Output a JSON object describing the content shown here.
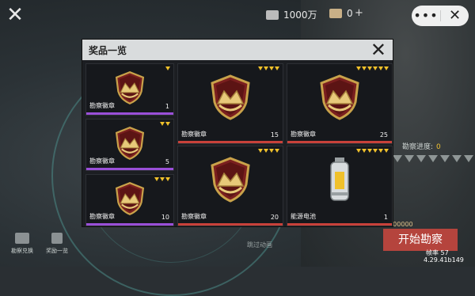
{
  "topbar": {
    "currency1": "1000万",
    "currency2": "0",
    "plus": "+",
    "close_glyph": "✕",
    "capsule_dots": "•••",
    "capsule_close": "✕"
  },
  "modal": {
    "title": "奖品一览",
    "close_glyph": "✕",
    "items": [
      {
        "name": "勘察徽章",
        "qty": "1",
        "stars": 1,
        "rarity": "purple"
      },
      {
        "name": "勘察徽章",
        "qty": "5",
        "stars": 2,
        "rarity": "purple"
      },
      {
        "name": "勘察徽章",
        "qty": "10",
        "stars": 3,
        "rarity": "purple"
      },
      {
        "name": "勘察徽章",
        "qty": "15",
        "stars": 4,
        "rarity": "red"
      },
      {
        "name": "勘察徽章",
        "qty": "20",
        "stars": 4,
        "rarity": "red"
      },
      {
        "name": "勘察徽章",
        "qty": "25",
        "stars": 6,
        "rarity": "red"
      },
      {
        "name": "能源电池",
        "qty": "1",
        "stars": 6,
        "rarity": "red"
      }
    ]
  },
  "hud": {
    "progress_label": "勘察进度:",
    "progress_value": "0",
    "cost": "2000000",
    "start_button": "开始勘察",
    "fps": "帧率 57",
    "version": "4.29.41b149",
    "exchange_label": "勘察兑换",
    "rewards_label": "奖励一览",
    "hint": "跳过动画"
  },
  "colors": {
    "star": "#f0c12b",
    "purple": "#9a4fd8",
    "red": "#c8413a",
    "start_button": "#b5443d"
  }
}
